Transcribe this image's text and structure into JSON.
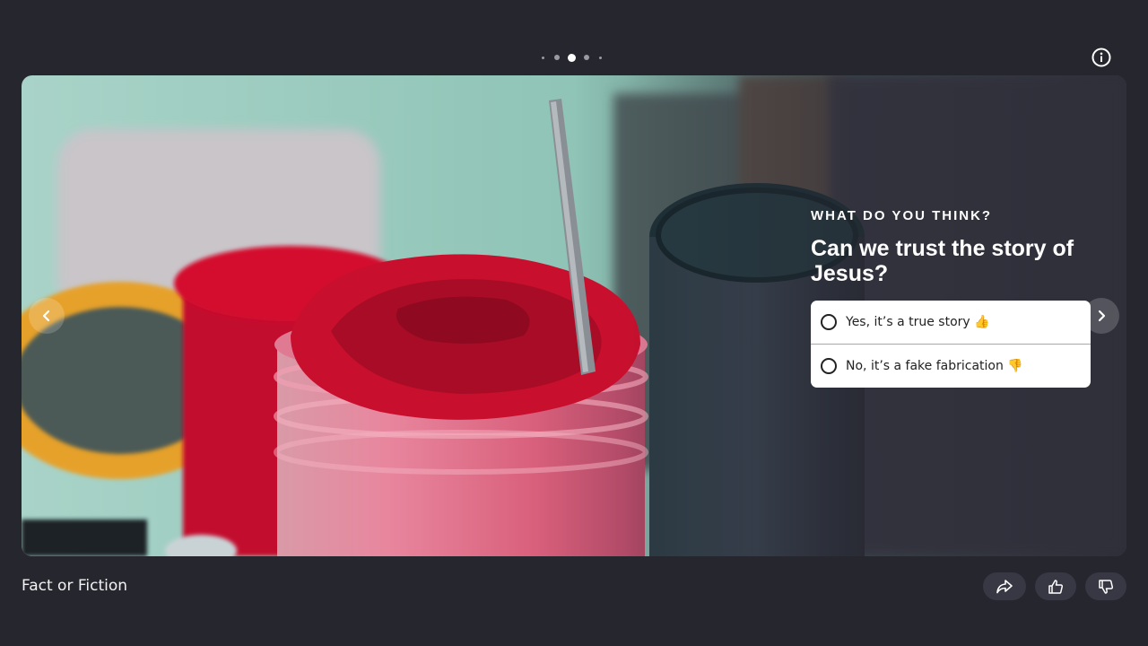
{
  "progress": {
    "total_slides": 5,
    "current_slide": 3
  },
  "slide": {
    "eyebrow": "WHAT DO YOU THINK?",
    "question": "Can we trust the story of Jesus?",
    "options": [
      {
        "label": "Yes, it’s a true story 👍"
      },
      {
        "label": "No, it’s a fake fabrication 👎"
      }
    ],
    "image_subject": "paint-jars-photo"
  },
  "footer": {
    "title": "Fact or Fiction"
  },
  "icons": {
    "info": "info-icon",
    "prev": "chevron-left-icon",
    "next": "chevron-right-icon",
    "share": "share-icon",
    "like": "thumbs-up-icon",
    "dislike": "thumbs-down-icon"
  },
  "colors": {
    "background": "#26262f",
    "button": "#383844",
    "option_bg": "#ffffff"
  }
}
